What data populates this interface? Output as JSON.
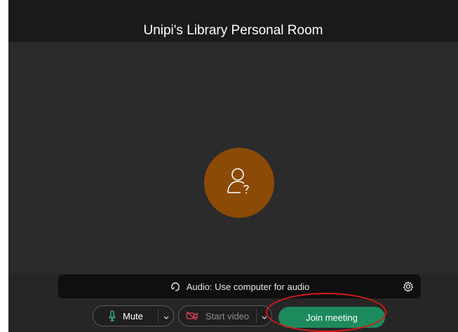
{
  "window": {
    "title": "Unipi's Library Personal Room"
  },
  "avatar": {
    "icon": "user-unknown-icon",
    "color": "#8b4a06"
  },
  "audio_bar": {
    "label": "Audio: Use computer for audio",
    "icon": "headset-icon",
    "settings_icon": "gear-icon"
  },
  "controls": {
    "mute": {
      "label": "Mute",
      "icon": "microphone-icon"
    },
    "video": {
      "label": "Start video",
      "icon": "video-off-icon"
    },
    "join": {
      "label": "Join meeting",
      "color": "#1d8a5d"
    }
  },
  "colors": {
    "accent_green": "#1d8a5d",
    "video_off_red": "#e0405a",
    "mic_green": "#3dbf7e",
    "highlight": "#d61a1a"
  }
}
